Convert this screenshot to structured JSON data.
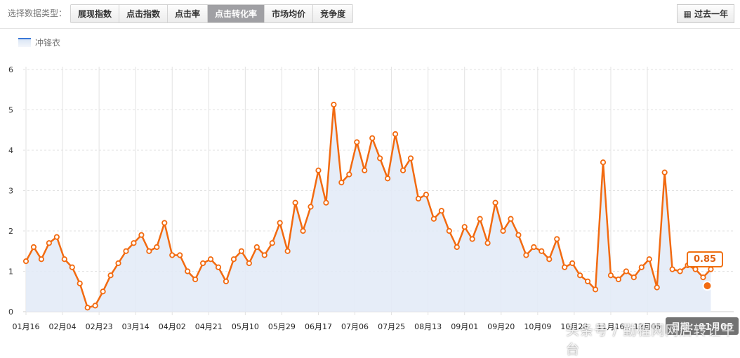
{
  "toolbar": {
    "label": "选择数据类型：",
    "tabs": [
      "展现指数",
      "点击指数",
      "点击率",
      "点击转化率",
      "市场均价",
      "竞争度"
    ],
    "active_tab": "点击转化率",
    "range_button": "过去一年"
  },
  "colors": {
    "line": "#f26a10",
    "area": "#dbe6f5",
    "active_tab": "#a0a0a4"
  },
  "tooltip": {
    "value": "0.85",
    "date_label": "日期：01月05"
  },
  "watermark": "头条号 / 勤程网网店转让平台",
  "chart_data": {
    "type": "line",
    "series": [
      {
        "name": "冲锋衣",
        "values": [
          1.25,
          1.6,
          1.3,
          1.7,
          1.85,
          1.3,
          1.1,
          0.7,
          0.1,
          0.15,
          0.5,
          0.9,
          1.2,
          1.5,
          1.7,
          1.9,
          1.5,
          1.6,
          2.2,
          1.4,
          1.4,
          1.0,
          0.8,
          1.2,
          1.3,
          1.1,
          0.75,
          1.3,
          1.5,
          1.2,
          1.6,
          1.4,
          1.7,
          2.2,
          1.5,
          2.7,
          2.0,
          2.6,
          3.5,
          2.7,
          5.13,
          3.2,
          3.4,
          4.2,
          3.5,
          4.3,
          3.8,
          3.3,
          4.4,
          3.5,
          3.8,
          2.8,
          2.9,
          2.3,
          2.5,
          2.0,
          1.6,
          2.1,
          1.8,
          2.3,
          1.7,
          2.7,
          2.0,
          2.3,
          1.9,
          1.4,
          1.6,
          1.5,
          1.3,
          1.8,
          1.1,
          1.2,
          0.9,
          0.75,
          0.55,
          3.7,
          0.9,
          0.8,
          1.0,
          0.85,
          1.1,
          1.3,
          0.6,
          3.45,
          1.05,
          1.0,
          1.15,
          1.05,
          0.85,
          1.05
        ]
      }
    ],
    "x": [
      "01-16",
      "01-20",
      "01-24",
      "01-28",
      "02-01",
      "02-05",
      "02-09",
      "02-13",
      "02-17",
      "02-21",
      "02-25",
      "03-01",
      "03-05",
      "03-09",
      "03-13",
      "03-17",
      "03-21",
      "03-25",
      "03-29",
      "04-02",
      "04-06",
      "04-10",
      "04-14",
      "04-18",
      "04-22",
      "04-26",
      "04-30",
      "05-04",
      "05-08",
      "05-12",
      "05-16",
      "05-20",
      "05-24",
      "05-28",
      "06-01",
      "06-05",
      "06-09",
      "06-13",
      "06-17",
      "06-21",
      "06-25",
      "06-29",
      "07-03",
      "07-07",
      "07-11",
      "07-15",
      "07-19",
      "07-23",
      "07-27",
      "07-31",
      "08-04",
      "08-08",
      "08-12",
      "08-16",
      "08-20",
      "08-24",
      "08-28",
      "09-01",
      "09-05",
      "09-09",
      "09-13",
      "09-17",
      "09-21",
      "09-25",
      "09-29",
      "10-03",
      "10-07",
      "10-11",
      "10-15",
      "10-19",
      "10-23",
      "10-27",
      "10-31",
      "11-04",
      "11-08",
      "11-12",
      "11-16",
      "11-20",
      "11-24",
      "11-28",
      "12-02",
      "12-06",
      "12-10",
      "12-14",
      "12-18",
      "12-22",
      "12-26",
      "12-30",
      "01-03",
      "01-07"
    ],
    "x_tick_labels": [
      "01月16",
      "02月04",
      "02月23",
      "03月14",
      "04月02",
      "04月21",
      "05月10",
      "05月29",
      "06月17",
      "07月06",
      "07月25",
      "08月13",
      "09月01",
      "09月20",
      "10月09",
      "10月28",
      "11月16",
      "12月05"
    ],
    "y_ticks": [
      "0",
      "1",
      "2",
      "3",
      "4",
      "5",
      "6"
    ],
    "ylim": [
      0,
      6
    ],
    "grid": true,
    "legend": "top-left"
  }
}
